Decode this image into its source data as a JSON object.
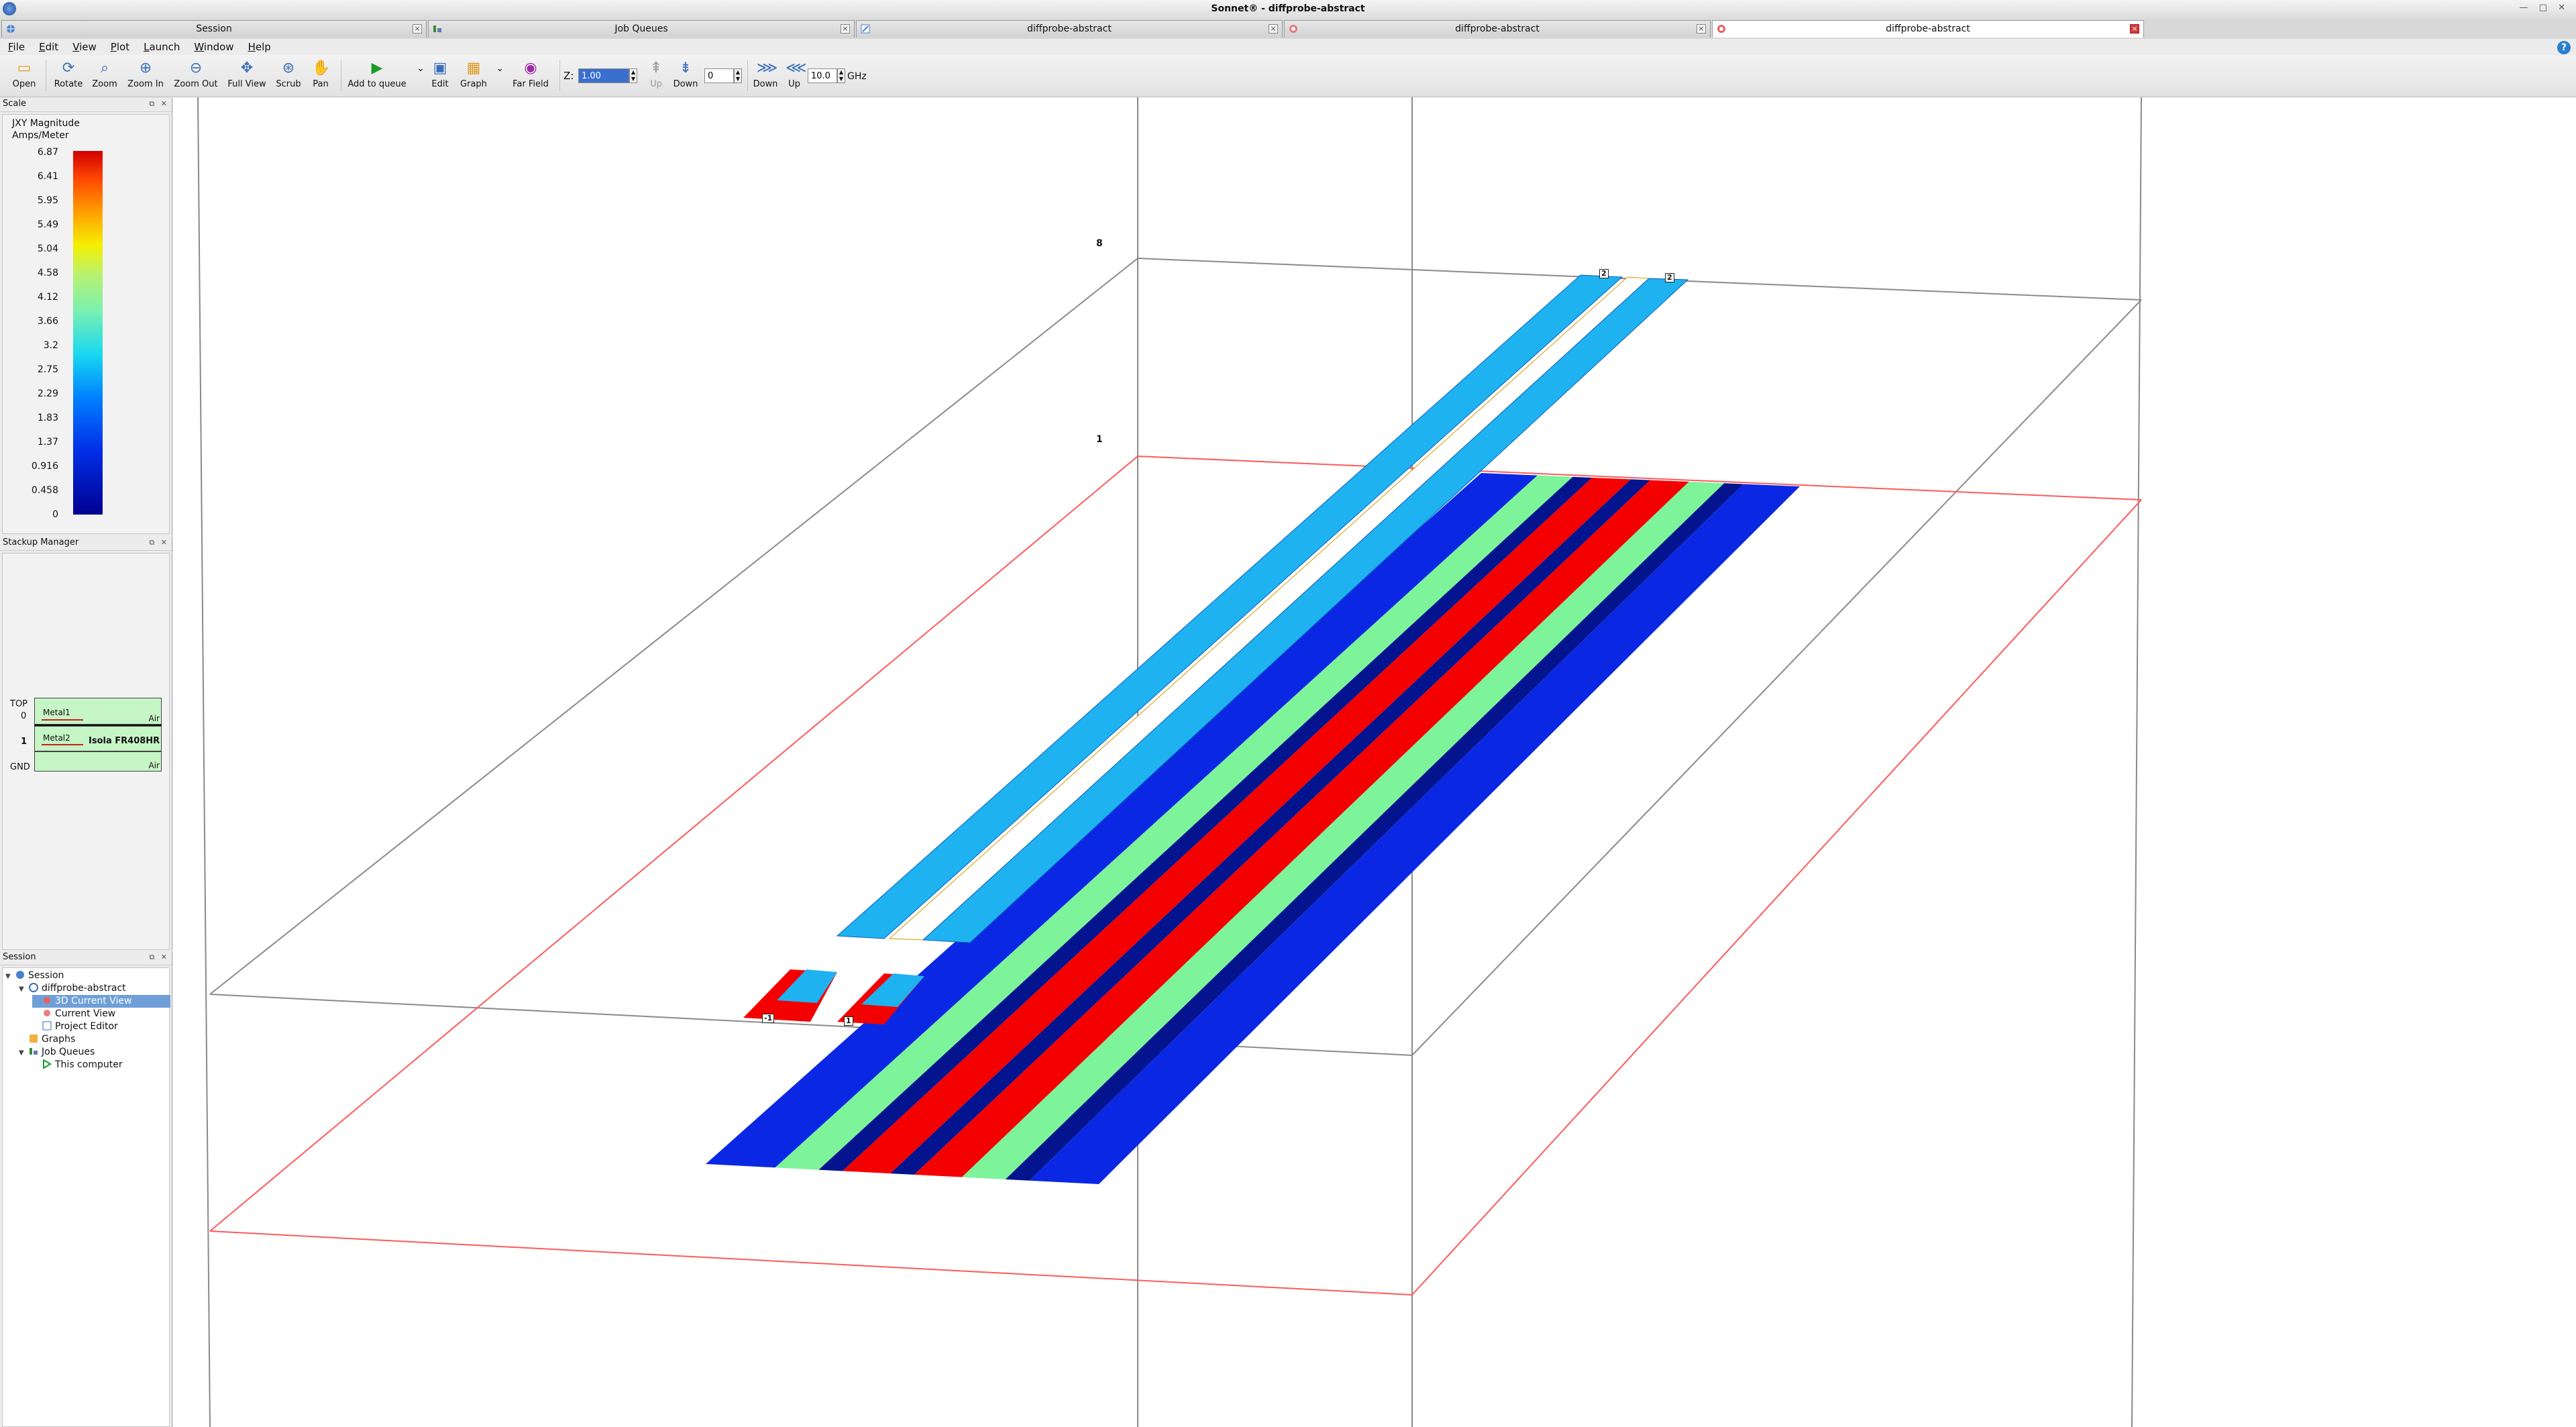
{
  "window": {
    "title": "Sonnet® - diffprobe-abstract"
  },
  "tabs": [
    {
      "label": "Session",
      "icon": "sonnet-globe-icon",
      "active": false
    },
    {
      "label": "Job Queues",
      "icon": "job-queue-icon",
      "active": false
    },
    {
      "label": "diffprobe-abstract",
      "icon": "project-editor-icon",
      "active": false
    },
    {
      "label": "diffprobe-abstract",
      "icon": "current-view-icon",
      "active": false
    },
    {
      "label": "diffprobe-abstract",
      "icon": "3d-current-view-icon",
      "active": true
    }
  ],
  "menu": [
    "File",
    "Edit",
    "View",
    "Plot",
    "Launch",
    "Window",
    "Help"
  ],
  "toolbar": {
    "open": "Open",
    "rotate": "Rotate",
    "zoom": "Zoom",
    "zoom_in": "Zoom In",
    "zoom_out": "Zoom Out",
    "full_view": "Full View",
    "scrub": "Scrub",
    "pan": "Pan",
    "add_to_queue": "Add to queue",
    "edit": "Edit",
    "graph": "Graph",
    "far_field": "Far Field",
    "z_label": "Z:",
    "z_value": "1.00",
    "level_up": "Up",
    "level_down": "Down",
    "level_value": "0",
    "freq_down": "Down",
    "freq_up": "Up",
    "freq_value": "10.0",
    "freq_unit": "GHz"
  },
  "scale_panel": {
    "header": "Scale",
    "quantity": "JXY Magnitude",
    "unit": "Amps/Meter",
    "ticks": [
      "6.87",
      "6.41",
      "5.95",
      "5.49",
      "5.04",
      "4.58",
      "4.12",
      "3.66",
      "3.2",
      "2.75",
      "2.29",
      "1.83",
      "1.37",
      "0.916",
      "0.458",
      "0"
    ]
  },
  "stackup_panel": {
    "header": "Stackup Manager",
    "top_label": "TOP",
    "gnd_label": "GND",
    "level0_num": "0",
    "level1_num": "1",
    "metal1": "Metal1",
    "metal2": "Metal2",
    "air_top": "Air",
    "air_bottom": "Air",
    "dielectric": "Isola FR408HR"
  },
  "session_panel": {
    "header": "Session",
    "items": [
      {
        "label": "Session",
        "icon": "sonnet-globe-icon"
      },
      {
        "label": "diffprobe-abstract",
        "icon": "project-icon"
      },
      {
        "label": "3D Current View",
        "icon": "3d-current-view-icon",
        "selected": true
      },
      {
        "label": "Current View",
        "icon": "current-view-icon"
      },
      {
        "label": "Project Editor",
        "icon": "project-editor-icon"
      },
      {
        "label": "Graphs",
        "icon": "graphs-icon"
      },
      {
        "label": "Job Queues",
        "icon": "job-queue-icon"
      },
      {
        "label": "This computer",
        "icon": "play-icon"
      }
    ]
  },
  "viewport": {
    "axis_labels": [
      "8",
      "1"
    ],
    "port_labels": [
      "2",
      "2",
      "-1",
      "1"
    ],
    "colors": {
      "red": "#f40000",
      "green": "#7df39a",
      "blue": "#0a28e4",
      "navy": "#03148e",
      "cyan": "#1fb2f0",
      "bounding_red": "#ff5a5a",
      "bounding_gray": "#8a8a8a"
    }
  }
}
